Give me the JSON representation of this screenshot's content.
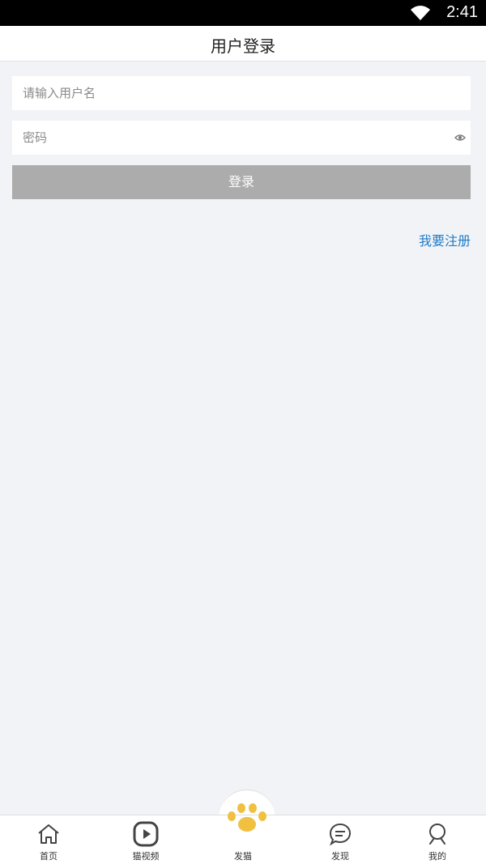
{
  "status_bar": {
    "time": "2:41"
  },
  "header": {
    "title": "用户登录"
  },
  "form": {
    "username_placeholder": "请输入用户名",
    "username_value": "",
    "password_placeholder": "密码",
    "password_value": "",
    "login_label": "登录",
    "register_label": "我要注册"
  },
  "tabbar": {
    "tabs": [
      {
        "label": "首页",
        "icon": "home-icon"
      },
      {
        "label": "猫视频",
        "icon": "play-icon"
      },
      {
        "label": "发猫",
        "icon": "paw-icon"
      },
      {
        "label": "发现",
        "icon": "chat-icon"
      },
      {
        "label": "我的",
        "icon": "profile-icon"
      }
    ]
  },
  "colors": {
    "background": "#f2f3f7",
    "link": "#1f7cc8",
    "button_disabled": "#acacac",
    "paw": "#f0c040"
  }
}
